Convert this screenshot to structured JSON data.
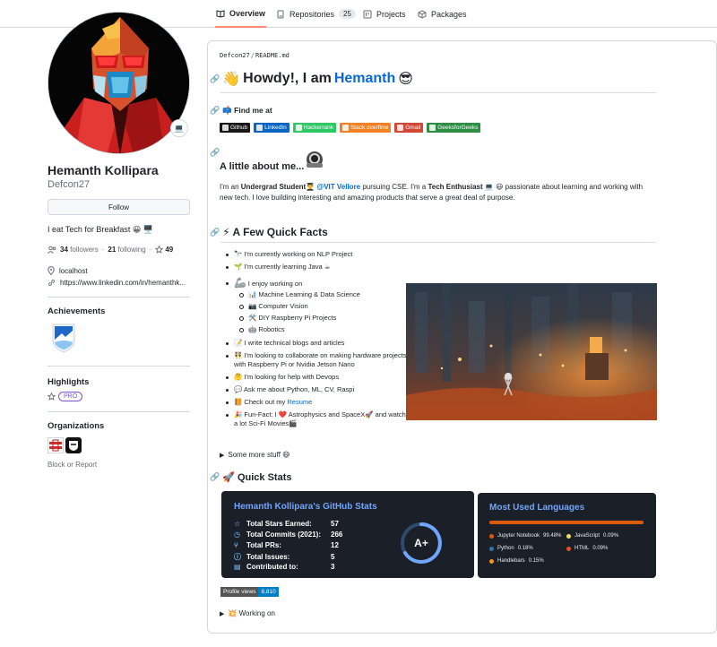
{
  "tabs": [
    {
      "label": "Overview",
      "icon": "book-icon"
    },
    {
      "label": "Repositories",
      "icon": "repo-icon",
      "count": "25"
    },
    {
      "label": "Projects",
      "icon": "project-icon"
    },
    {
      "label": "Packages",
      "icon": "package-icon"
    }
  ],
  "profile": {
    "name": "Hemanth Kollipara",
    "login": "Defcon27",
    "follow_label": "Follow",
    "bio": "I eat Tech for Breakfast 😀 🖥️",
    "followers_count": "34",
    "followers_label": "followers",
    "following_count": "21",
    "following_label": "following",
    "stars_count": "49",
    "location": "localhost",
    "website": "https://www.linkedin.com/in/hemanthk...",
    "status_emoji": "💻"
  },
  "sidebar": {
    "achievements_title": "Achievements",
    "highlights_title": "Highlights",
    "pro_label": "PRO",
    "organizations_title": "Organizations",
    "block_label": "Block or Report"
  },
  "readme": {
    "crumb_user": "Defcon27",
    "crumb_file": "README.md",
    "greeting_wave": "👋",
    "greeting_text": "Howdy!, I am",
    "greeting_name": "Hemanth",
    "greeting_emoji": "😎",
    "find_me": "📫 Find me at",
    "badges": [
      {
        "label": "Github",
        "color": "#181717"
      },
      {
        "label": "LinkedIn",
        "color": "#0a66c2"
      },
      {
        "label": "Hackerrank",
        "color": "#2ec866"
      },
      {
        "label": "Stack overflow",
        "color": "#f48024"
      },
      {
        "label": "Gmail",
        "color": "#d14836"
      },
      {
        "label": "GeeksforGeeks",
        "color": "#2f8d46"
      }
    ],
    "about_title": "A little about me...",
    "about_pre": "I'm an ",
    "about_b1": "Undergrad Student",
    "about_e1": "👨‍🎓 ",
    "about_link": "@VIT Vellore",
    "about_mid": " pursuing CSE. I'm a ",
    "about_b2": "Tech Enthusiast",
    "about_post": " 💻 😃 passionate about learning and working with new tech. I love building interesting and amazing products that serve a great deal of purpose.",
    "facts_title": "⚡ A Few Quick Facts",
    "facts": {
      "f1": "🔭 I'm currently working on NLP Project",
      "f2": "🌱 I'm currently learning Java ☕",
      "f3": "I enjoy working on",
      "sub": [
        "📊 Machine Learning & Data Science",
        "📷 Computer Vision",
        "🛠️ DIY Raspberry Pi Projects",
        "🤖 Robotics"
      ],
      "f4": "📝 I write technical blogs and articles",
      "f5": "👯 I'm looking to collaborate on making hardware projects with Raspberry Pi or Nvidia Jetson Nano",
      "f6": "🤔 I'm looking for help with Devops",
      "f7": "💬 Ask me about Python, ML, CV, Raspi",
      "f8_pre": "📙 Check out my ",
      "f8_link": "Resume",
      "f9": "🎉 Fun-Fact: I ❤️ Astrophysics and SpaceX🚀 and watch a lot Sci-Fi Movies🎬"
    },
    "more_stuff": "Some more stuff 😄",
    "quick_stats": "🚀 Quick Stats",
    "working_on": "💥 Working on",
    "profile_views_label": "Profile views",
    "profile_views_value": "8,810"
  },
  "github_stats": {
    "title": "Hemanth Kollipara's GitHub Stats",
    "rows": [
      {
        "label": "Total Stars Earned:",
        "value": "57",
        "icon": "star-icon"
      },
      {
        "label": "Total Commits (2021):",
        "value": "266",
        "icon": "clock-icon"
      },
      {
        "label": "Total PRs:",
        "value": "12",
        "icon": "pr-icon"
      },
      {
        "label": "Total Issues:",
        "value": "5",
        "icon": "issue-icon"
      },
      {
        "label": "Contributed to:",
        "value": "3",
        "icon": "repo-icon"
      }
    ],
    "grade": "A+",
    "ring_color": "#70a5fd"
  },
  "languages": {
    "title": "Most Used Languages",
    "items": [
      {
        "name": "Jupyter Notebook",
        "percent": "99.48%",
        "color": "#da5b0b"
      },
      {
        "name": "JavaScript",
        "percent": "0.09%",
        "color": "#f1e05a"
      },
      {
        "name": "Python",
        "percent": "0.18%",
        "color": "#3572a5"
      },
      {
        "name": "HTML",
        "percent": "0.09%",
        "color": "#e34c26"
      },
      {
        "name": "Handlebars",
        "percent": "0.15%",
        "color": "#f7931e"
      }
    ]
  }
}
